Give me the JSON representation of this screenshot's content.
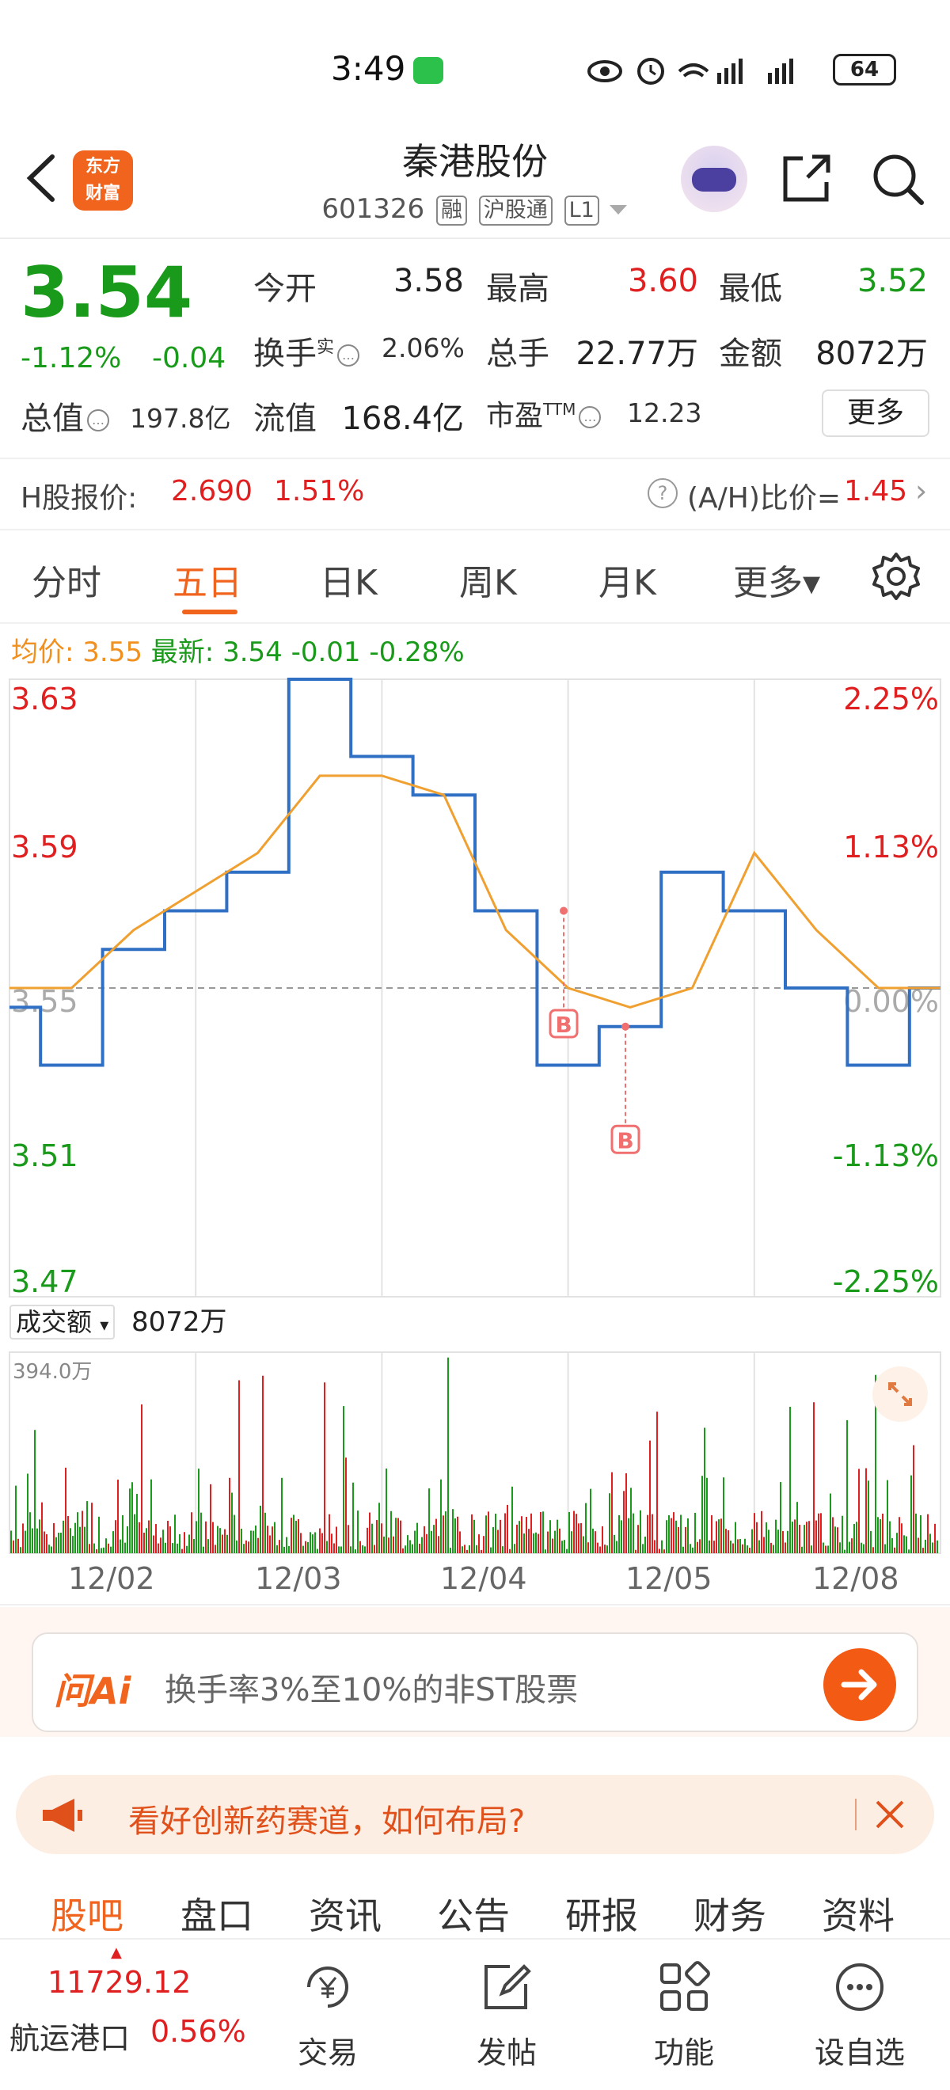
{
  "status_bar": {
    "time": "3:49",
    "signal_text": " ⊙ ⏰ ᵃ≋ ⁵ᴳ▮▮▮ ⁴ᴳ▮▮▮",
    "battery": "64"
  },
  "header": {
    "logo_line1": "东方",
    "logo_line2": "财富",
    "stock_name": "秦港股份",
    "stock_code": "601326",
    "tags": [
      "融",
      "沪股通",
      "L1"
    ]
  },
  "quote": {
    "price": "3.54",
    "pct_change": "-1.12%",
    "abs_change": "-0.04",
    "open_label": "今开",
    "open": "3.58",
    "high_label": "最高",
    "high": "3.60",
    "low_label": "最低",
    "low": "3.52",
    "turnover_label": "换手",
    "turnover_sup": "实",
    "turnover": "2.06%",
    "volume_label": "总手",
    "volume": "22.77万",
    "amount_label": "金额",
    "amount": "8072万",
    "mktcap_label": "总值",
    "mktcap": "197.8亿",
    "float_label": "流值",
    "float": "168.4亿",
    "pe_label": "市盈",
    "pe_sup": "TTM",
    "pe": "12.23",
    "more_label": "更多"
  },
  "h_share": {
    "label": "H股报价:",
    "price": "2.690",
    "pct": "1.51%",
    "ah_label": "(A/H)比价=",
    "ah_value": "1.45"
  },
  "chart_tabs": [
    "分时",
    "五日",
    "日K",
    "周K",
    "月K",
    "更多▾"
  ],
  "avg_line": {
    "avg_label": "均价:",
    "avg": "3.55",
    "latest_label": "最新:",
    "latest": "3.54",
    "change": "-0.01",
    "pct": "-0.28%"
  },
  "chart_data": {
    "type": "line",
    "x": [
      "12/02",
      "12/03",
      "12/04",
      "12/05",
      "12/08"
    ],
    "series": [
      {
        "name": "",
        "color": "#2f6fc4",
        "values": [
          3.545,
          3.53,
          3.56,
          3.57,
          3.58,
          3.63,
          3.61,
          3.6,
          3.57,
          3.53,
          3.54,
          3.58,
          3.57,
          3.55,
          3.53,
          3.55
        ]
      },
      {
        "name": "均价",
        "color": "#f0a030",
        "values": [
          3.55,
          3.55,
          3.565,
          3.575,
          3.585,
          3.605,
          3.605,
          3.6,
          3.565,
          3.55,
          3.545,
          3.55,
          3.585,
          3.565,
          3.55,
          3.55
        ]
      }
    ],
    "ylim": [
      3.47,
      3.63
    ],
    "y_ticks_left": [
      "3.63",
      "3.59",
      "3.55",
      "3.51",
      "3.47"
    ],
    "y_ticks_right": [
      "2.25%",
      "1.13%",
      "0.00%",
      "-1.13%",
      "-2.25%"
    ],
    "markers": [
      "B",
      "B"
    ],
    "volume": {
      "selector_label": "成交额",
      "value": "8072万",
      "max_label": "394.0万"
    },
    "date_labels": [
      "12/02",
      "12/03",
      "12/04",
      "12/05",
      "12/08"
    ]
  },
  "ai": {
    "logo": "问Ai",
    "prompt": "换手率3%至10%的非ST股票"
  },
  "banner": {
    "text": "看好创新药赛道，如何布局?"
  },
  "bottom_tabs": [
    "股吧",
    "盘口",
    "资讯",
    "公告",
    "研报",
    "财务",
    "资料"
  ],
  "footer": {
    "index_value": "11729.12",
    "index_name": "航运港口",
    "index_pct": "0.56%",
    "buttons": [
      "交易",
      "发帖",
      "功能",
      "设自选"
    ]
  },
  "colors": {
    "up": "#e02020",
    "down": "#1a9a1a",
    "accent": "#f0641e",
    "price_line": "#2f6fc4",
    "avg_line": "#f0a030"
  }
}
